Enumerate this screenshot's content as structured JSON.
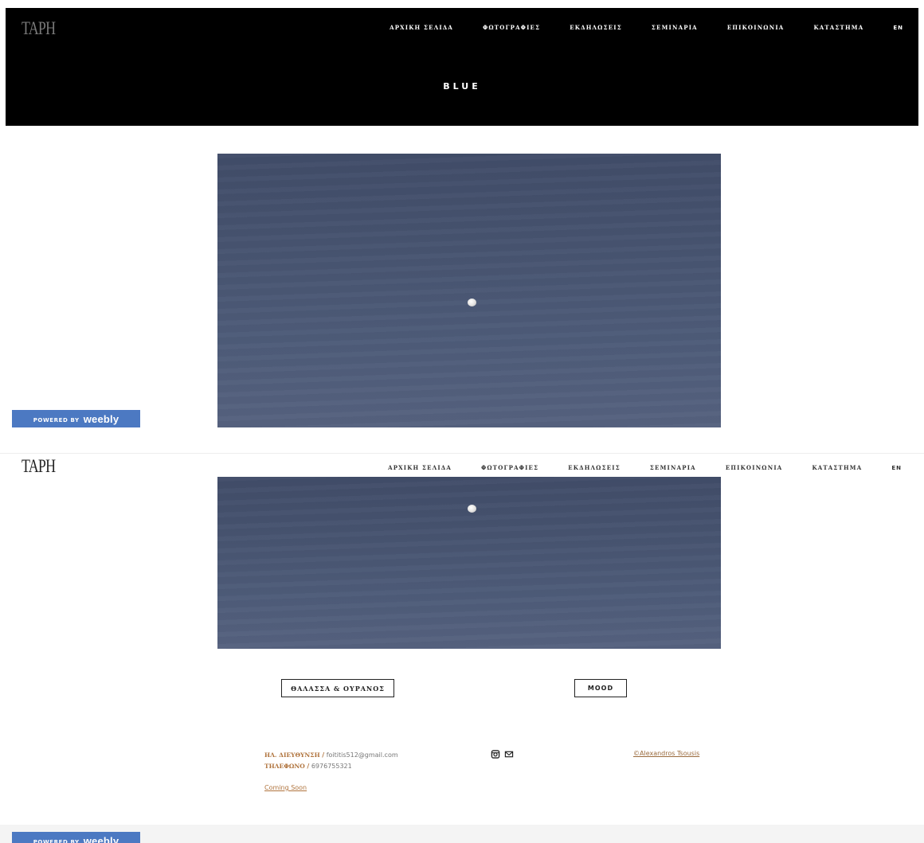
{
  "brand": {
    "logo": "TAPH"
  },
  "nav": {
    "items": [
      "ΑΡΧΙΚΗ ΣΕΛΙΔΑ",
      "ΦΩΤΟΓΡΑΦΙΕΣ",
      "ΕΚΔΗΛΩΣΕΙΣ",
      "ΣΕΜΙΝΑΡΙΑ",
      "ΕΠΙΚΟΙΝΩΝΙΑ",
      "ΚΑΤΑΣΤΗΜΑ"
    ],
    "lang": "EN"
  },
  "hero": {
    "title": "BLUE"
  },
  "weebly": {
    "prefix": "POWERED BY",
    "brand": "weebly"
  },
  "gallery_links": {
    "sea_sky": "ΘΑΛΑΣΣΑ & ΟΥΡΑΝΟΣ",
    "mood": "MOOD"
  },
  "footer": {
    "email_label": "ΗΛ. ΔΙΕΥΘΥΝΣΗ",
    "email": "foititis512@gmail.com",
    "phone_label": "ΤΗΛΕΦΩΝΟ",
    "phone": "6976755321",
    "separator": "/",
    "coming_soon": "Coming Soon",
    "credit": "©Alexandros Tsousis",
    "social_icons": [
      "instagram-icon",
      "mail-icon"
    ]
  },
  "colors": {
    "hero_bg": "#000000",
    "accent": "#b0743e",
    "weebly_blue": "#4c79c2",
    "photo_sky": "#4a5773"
  }
}
